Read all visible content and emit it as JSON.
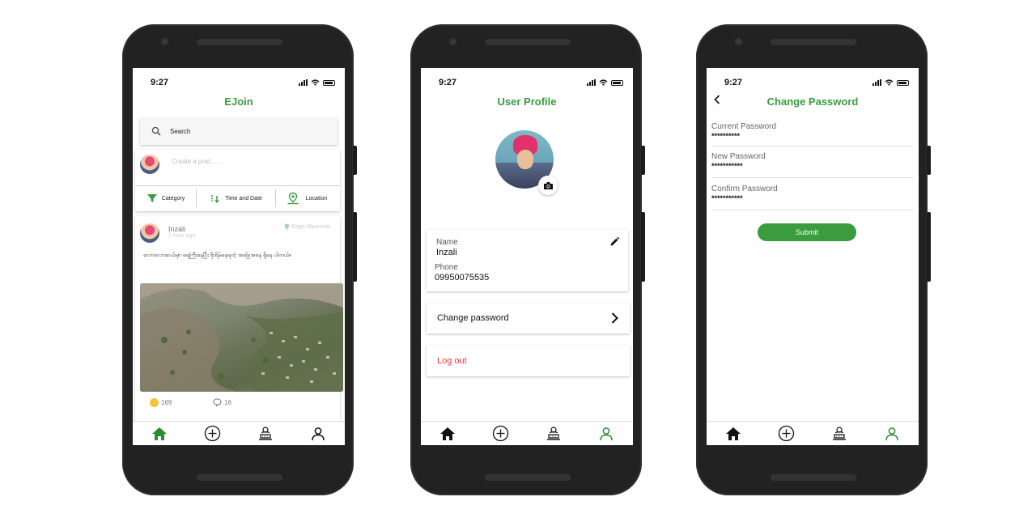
{
  "colors": {
    "accent": "#3a9c3f",
    "danger": "#e53935"
  },
  "status_time": "9:27",
  "feed": {
    "title": "EJoin",
    "search_placeholder": "Search",
    "create_post_placeholder": "Create a post.......",
    "filters": [
      {
        "label": "Category",
        "icon": "funnel-icon"
      },
      {
        "label": "Time and Date",
        "icon": "sort-icon"
      },
      {
        "label": "Location",
        "icon": "location-icon"
      }
    ],
    "post": {
      "author": "Inzali",
      "time": "1 hour ago",
      "location": "Bago,Myanmar",
      "text": "လောလောဆယ်မှာ ရေကြီးနေပြီး စိုးရိမ်နေရတဲ့ အခြေအနေ ရှိနေ ပါတယ်။",
      "reactions": "169",
      "comments": "16"
    }
  },
  "profile": {
    "title": "User Profile",
    "name_label": "Name",
    "name_value": "Inzali",
    "phone_label": "Phone",
    "phone_value": "09950075535",
    "change_password": "Change password",
    "logout": "Log out"
  },
  "change_password": {
    "title": "Change Password",
    "current_label": "Current Password",
    "current_value": "**********",
    "new_label": "New Password",
    "new_value": "***********",
    "confirm_label": "Confirm Password",
    "confirm_value": "***********",
    "submit": "Submit"
  },
  "tabs": [
    "home-icon",
    "add-icon",
    "protest-icon",
    "user-icon"
  ]
}
